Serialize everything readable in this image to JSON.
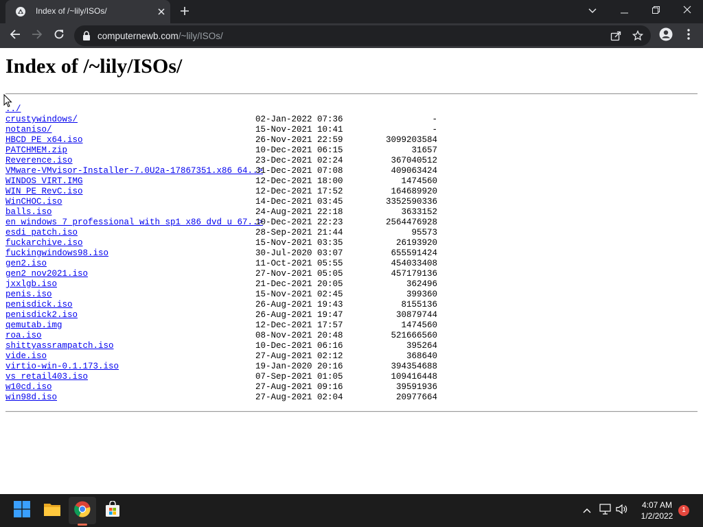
{
  "browser": {
    "tab_title": "Index of /~lily/ISOs/",
    "url_host": "computernewb.com",
    "url_path": "/~lily/ISOs/",
    "icons": [
      "favicon-icon",
      "close-icon",
      "plus-icon",
      "chevron-down-icon",
      "minimize-icon",
      "restore-icon",
      "window-close-icon",
      "back-icon",
      "forward-icon",
      "reload-icon",
      "lock-icon",
      "share-icon",
      "star-icon",
      "profile-icon",
      "menu-icon"
    ]
  },
  "page": {
    "heading": "Index of /~lily/ISOs/",
    "parent_link": "../",
    "entries": [
      {
        "name": "crustywindows/",
        "date": "02-Jan-2022 07:36",
        "size": "-"
      },
      {
        "name": "notaniso/",
        "date": "15-Nov-2021 10:41",
        "size": "-"
      },
      {
        "name": "HBCD_PE_x64.iso",
        "date": "26-Nov-2021 22:59",
        "size": "3099203584"
      },
      {
        "name": "PATCHMEM.zip",
        "date": "10-Dec-2021 06:15",
        "size": "31657"
      },
      {
        "name": "Reverence.iso",
        "date": "23-Dec-2021 02:24",
        "size": "367040512"
      },
      {
        "name": "VMware-VMvisor-Installer-7.0U2a-17867351.x86_64..>",
        "date": "31-Dec-2021 07:08",
        "size": "409063424"
      },
      {
        "name": "WINDOS_VIRT.IMG",
        "date": "12-Dec-2021 18:00",
        "size": "1474560"
      },
      {
        "name": "WIN_PE_RevC.iso",
        "date": "12-Dec-2021 17:52",
        "size": "164689920"
      },
      {
        "name": "WinCHOC.iso",
        "date": "14-Dec-2021 03:45",
        "size": "3352590336"
      },
      {
        "name": "balls.iso",
        "date": "24-Aug-2021 22:18",
        "size": "3633152"
      },
      {
        "name": "en_windows_7_professional_with_sp1_x86_dvd_u_67..>",
        "date": "10-Dec-2021 22:23",
        "size": "2564476928"
      },
      {
        "name": "esdi_patch.iso",
        "date": "28-Sep-2021 21:44",
        "size": "95573"
      },
      {
        "name": "fuckarchive.iso",
        "date": "15-Nov-2021 03:35",
        "size": "26193920"
      },
      {
        "name": "fuckingwindows98.iso",
        "date": "30-Jul-2020 03:07",
        "size": "655591424"
      },
      {
        "name": "gen2.iso",
        "date": "11-Oct-2021 05:55",
        "size": "454033408"
      },
      {
        "name": "gen2_nov2021.iso",
        "date": "27-Nov-2021 05:05",
        "size": "457179136"
      },
      {
        "name": "jxxlgb.iso",
        "date": "21-Dec-2021 20:05",
        "size": "362496"
      },
      {
        "name": "penis.iso",
        "date": "15-Nov-2021 02:45",
        "size": "399360"
      },
      {
        "name": "penisdick.iso",
        "date": "26-Aug-2021 19:43",
        "size": "8155136"
      },
      {
        "name": "penisdick2.iso",
        "date": "26-Aug-2021 19:47",
        "size": "30879744"
      },
      {
        "name": "qemutab.img",
        "date": "12-Dec-2021 17:57",
        "size": "1474560"
      },
      {
        "name": "roa.iso",
        "date": "08-Nov-2021 20:48",
        "size": "521666560"
      },
      {
        "name": "shittyassrampatch.iso",
        "date": "10-Dec-2021 06:16",
        "size": "395264"
      },
      {
        "name": "vide.iso",
        "date": "27-Aug-2021 02:12",
        "size": "368640"
      },
      {
        "name": "virtio-win-0.1.173.iso",
        "date": "19-Jan-2020 20:16",
        "size": "394354688"
      },
      {
        "name": "vs_retail403.iso",
        "date": "07-Sep-2021 01:05",
        "size": "109416448"
      },
      {
        "name": "w10cd.iso",
        "date": "27-Aug-2021 09:16",
        "size": "39591936"
      },
      {
        "name": "win98d.iso",
        "date": "27-Aug-2021 02:04",
        "size": "20977664"
      }
    ]
  },
  "taskbar": {
    "time": "4:07 AM",
    "date": "1/2/2022",
    "notification_count": "1",
    "apps": [
      "start-icon",
      "file-explorer-icon",
      "chrome-icon",
      "store-icon"
    ],
    "tray": [
      "chevron-up-icon",
      "network-icon",
      "volume-icon"
    ]
  },
  "colors": {
    "link": "#0000ee",
    "titlebar": "#202124",
    "toolbar": "#35363a",
    "taskbar": "#1c1c1c",
    "notification": "#e5473d"
  }
}
